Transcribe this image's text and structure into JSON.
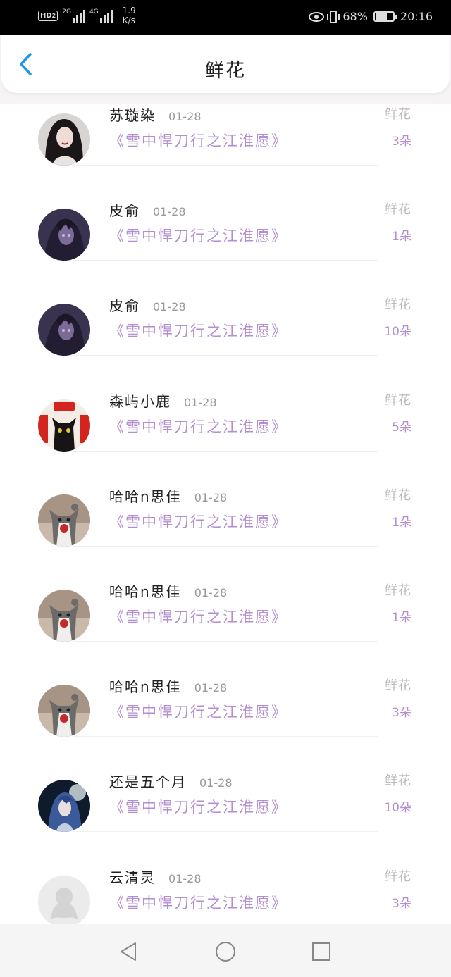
{
  "status_bar": {
    "hd_label": "HD",
    "hd_sub": "2",
    "sim1_label": "2G",
    "sim2_label": "4G",
    "speed_value": "1.9",
    "speed_unit": "K/s",
    "battery": "68%",
    "battery_level": 0.68,
    "time": "20:16"
  },
  "header": {
    "title": "鲜花",
    "back_icon": "chevron-left-icon",
    "accent_color": "#1e96e6"
  },
  "rows": [
    {
      "name": "苏璇染",
      "date": "01-28",
      "book": "《雪中悍刀行之江淮愿》",
      "type": "鲜花",
      "count": "3朵",
      "avatar": "avatar-dark-hair-woman"
    },
    {
      "name": "皮俞",
      "date": "01-28",
      "book": "《雪中悍刀行之江淮愿》",
      "type": "鲜花",
      "count": "1朵",
      "avatar": "avatar-purple-figure"
    },
    {
      "name": "皮俞",
      "date": "01-28",
      "book": "《雪中悍刀行之江淮愿》",
      "type": "鲜花",
      "count": "10朵",
      "avatar": "avatar-purple-figure"
    },
    {
      "name": "森屿小鹿",
      "date": "01-28",
      "book": "《雪中悍刀行之江淮愿》",
      "type": "鲜花",
      "count": "5朵",
      "avatar": "avatar-black-cat-festive"
    },
    {
      "name": "哈哈n思佳",
      "date": "01-28",
      "book": "《雪中悍刀行之江淮愿》",
      "type": "鲜花",
      "count": "1朵",
      "avatar": "avatar-grey-cat"
    },
    {
      "name": "哈哈n思佳",
      "date": "01-28",
      "book": "《雪中悍刀行之江淮愿》",
      "type": "鲜花",
      "count": "1朵",
      "avatar": "avatar-grey-cat"
    },
    {
      "name": "哈哈n思佳",
      "date": "01-28",
      "book": "《雪中悍刀行之江淮愿》",
      "type": "鲜花",
      "count": "3朵",
      "avatar": "avatar-grey-cat"
    },
    {
      "name": "还是五个月",
      "date": "01-28",
      "book": "《雪中悍刀行之江淮愿》",
      "type": "鲜花",
      "count": "10朵",
      "avatar": "avatar-anime-blue"
    },
    {
      "name": "云清灵",
      "date": "01-28",
      "book": "《雪中悍刀行之江淮愿》",
      "type": "鲜花",
      "count": "3朵",
      "avatar": "avatar-default-penguin"
    }
  ],
  "colors": {
    "book_text": "#b38fd0",
    "type_text": "#bbbbbb",
    "name_text": "#222222",
    "date_text": "#999999"
  },
  "navbar": {
    "back_icon": "triangle-back-icon",
    "home_icon": "circle-home-icon",
    "recents_icon": "square-recents-icon"
  }
}
